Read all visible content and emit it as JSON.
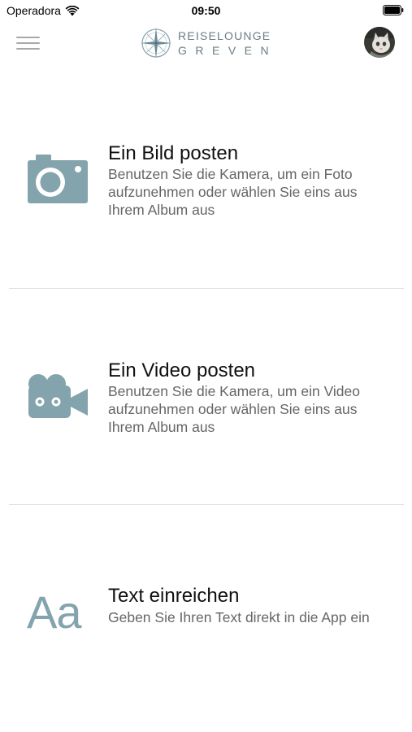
{
  "status_bar": {
    "carrier": "Operadora",
    "time": "09:50",
    "wifi_icon": "wifi-icon",
    "battery_icon": "battery-icon"
  },
  "nav_bar": {
    "menu_icon": "hamburger-menu-icon",
    "logo": {
      "line1": "REISELOUNGE",
      "line2": "GREVEN",
      "icon": "compass-rose-icon"
    },
    "avatar_icon": "user-avatar"
  },
  "options": [
    {
      "icon": "camera-icon",
      "title": "Ein Bild posten",
      "description": "Benutzen Sie die Kamera, um ein Foto aufzunehmen oder wählen Sie eins aus Ihrem Album aus"
    },
    {
      "icon": "video-camera-icon",
      "title": "Ein Video posten",
      "description": "Benutzen Sie die Kamera, um ein Video aufzunehmen oder wählen Sie eins aus Ihrem Album aus"
    },
    {
      "icon": "text-icon",
      "icon_text": "Aa",
      "title": "Text einreichen",
      "description": "Geben Sie Ihren Text direkt in die App ein"
    }
  ],
  "colors": {
    "icon_accent": "#83a3ad",
    "logo_text": "#6b7c85",
    "divider": "#dcdcdc",
    "description_text": "#666666"
  }
}
